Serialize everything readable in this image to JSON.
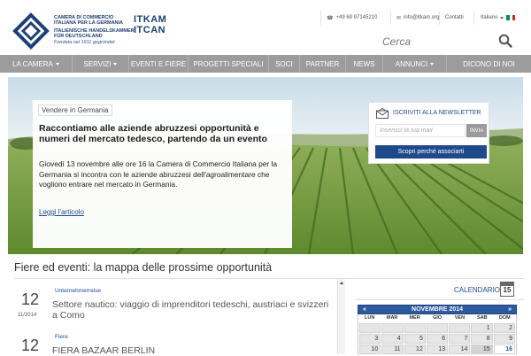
{
  "header": {
    "logo_lines": [
      "CAMERA DI COMMERCIO",
      "ITALIANA PER LA GERMANIA",
      "ITALIENISCHE HANDELSKAMMER",
      "FÜR DEUTSCHLAND"
    ],
    "logo_founded": "Fondata nel 1911 gegründet",
    "itkam_top": "ITKAM",
    "itkam_bottom": "ITCAN",
    "phone": "+49 69 97145210",
    "email": "info@itkam.org",
    "contacts": "Contatti",
    "language": "Italiano",
    "search_placeholder": "Cerca"
  },
  "nav": {
    "items": [
      {
        "label": "LA CAMERA",
        "dropdown": true
      },
      {
        "label": "SERVIZI",
        "dropdown": true
      },
      {
        "label": "EVENTI E FIERE",
        "dropdown": false
      },
      {
        "label": "PROGETTI SPECIALI",
        "dropdown": false
      },
      {
        "label": "SOCI",
        "dropdown": false
      },
      {
        "label": "PARTNER",
        "dropdown": false
      },
      {
        "label": "NEWS",
        "dropdown": false
      },
      {
        "label": "ANNUNCI",
        "dropdown": true
      },
      {
        "label": "DICONO DI NOI",
        "dropdown": false
      }
    ]
  },
  "hero": {
    "category": "Vendere in Germania",
    "title": "Raccontiamo alle aziende abruzzesi opportunità e numeri del mercato tedesco, partendo da un evento",
    "body": "Giovedì 13 novembre alle ore 16 la Camera di Commercio Italiana per la Germania si incontra con le aziende abruzzesi dell'agroalimentare che vogliono entrare nel mercato in Germania.",
    "link": "Leggi l'articolo"
  },
  "newsletter": {
    "title": "ISCRIVITI ALLA NEWSLETTER",
    "placeholder": "Inserisci la tua mail",
    "send": "INVIA",
    "discover": "Scopri perché associarti"
  },
  "events": {
    "section_title": "Fiere ed eventi: la mappa delle prossime opportunità",
    "items": [
      {
        "day": "12",
        "month_year": "11/2014",
        "category": "Unternehmerreise",
        "title": "Settore nautico: viaggio di imprenditori tedeschi, austriaci e svizzeri a Como"
      },
      {
        "day": "12",
        "month_year": "",
        "category": "Fiere",
        "title": "FIERA BAZAAR BERLIN"
      }
    ]
  },
  "calendar": {
    "label": "CALENDARIO",
    "icon_day": "15",
    "prev": "«",
    "month": "NOVEMBRE 2014",
    "next": "»",
    "weekdays": [
      "LUN",
      "MAR",
      "MER",
      "GIO",
      "VEN",
      "SAB",
      "DOM"
    ],
    "cells": [
      "",
      "",
      "",
      "",
      "",
      "1",
      "2",
      "3",
      "4",
      "5",
      "6",
      "7",
      "8",
      "9",
      "10",
      "11",
      "12",
      "13",
      "14",
      "15",
      "16"
    ],
    "today": "16",
    "highlighted": "15"
  },
  "colors": {
    "brand_blue": "#1e4a8c",
    "nav_gray": "#9c9c9c",
    "calendar_blue": "#2c5a9e"
  }
}
